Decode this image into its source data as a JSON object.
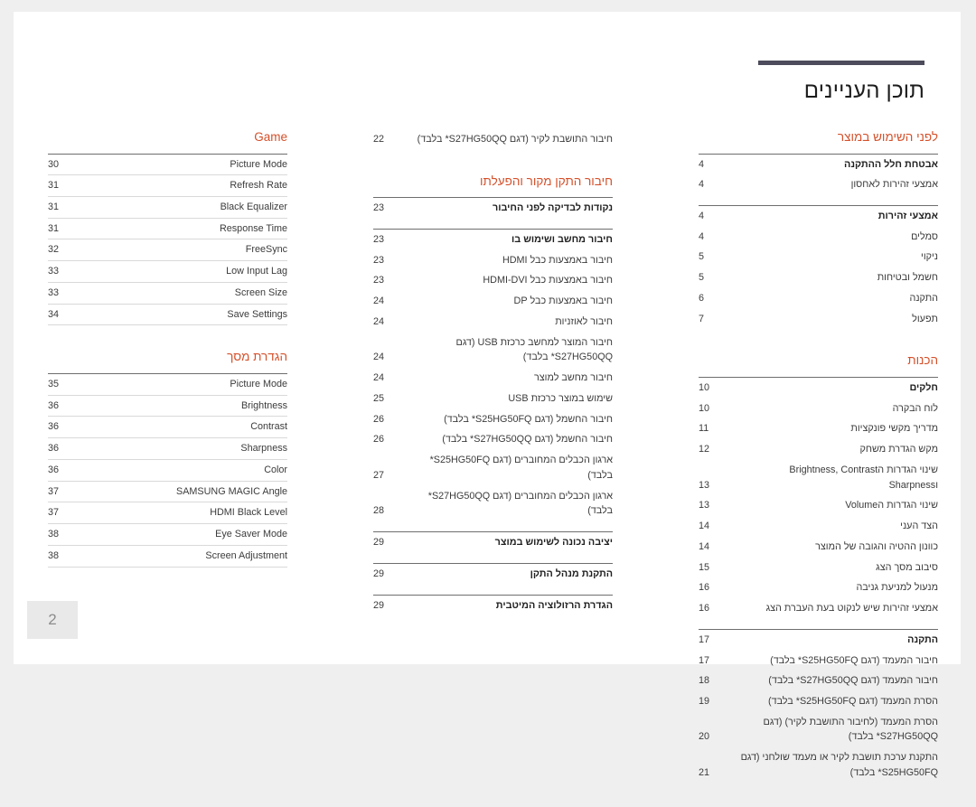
{
  "header": {
    "title": "תוכן העניינים"
  },
  "page_number": "2",
  "colors": {
    "accent": "#d4502a",
    "rule": "#4c4c5c",
    "text": "#3b3b3b",
    "page_bg": "#ffffff",
    "canvas_bg": "#efefef"
  },
  "columns": {
    "right": [
      {
        "title": "לפני השימוש במוצר",
        "title_dir": "rtl",
        "rule_each": false,
        "groups": [
          {
            "rows": [
              {
                "text": "אבטחת חלל ההתקנה",
                "page": "4",
                "bold": true,
                "dir": "rtl"
              },
              {
                "text": "אמצעי זהירות לאחסון",
                "page": "4",
                "bold": false,
                "dir": "rtl"
              }
            ]
          },
          {
            "rows": [
              {
                "text": "אמצעי זהירות",
                "page": "4",
                "bold": true,
                "dir": "rtl"
              },
              {
                "text": "סמלים",
                "page": "4",
                "bold": false,
                "dir": "rtl"
              },
              {
                "text": "ניקוי",
                "page": "5",
                "bold": false,
                "dir": "rtl"
              },
              {
                "text": "חשמל ובטיחות",
                "page": "5",
                "bold": false,
                "dir": "rtl"
              },
              {
                "text": "התקנה",
                "page": "6",
                "bold": false,
                "dir": "rtl"
              },
              {
                "text": "תפעול",
                "page": "7",
                "bold": false,
                "dir": "rtl"
              }
            ]
          }
        ]
      },
      {
        "title": "הכנות",
        "title_dir": "rtl",
        "rule_each": false,
        "groups": [
          {
            "rows": [
              {
                "text": "חלקים",
                "page": "10",
                "bold": true,
                "dir": "rtl"
              },
              {
                "text": "לוח הבקרה",
                "page": "10",
                "bold": false,
                "dir": "rtl"
              },
              {
                "text": "מדריך מקשי פונקציות",
                "page": "11",
                "bold": false,
                "dir": "rtl"
              },
              {
                "text": "מקש הגדרת משחק",
                "page": "12",
                "bold": false,
                "dir": "rtl"
              },
              {
                "text": "שינוי הגדרות הBrightness, Contrast וSharpness",
                "page": "13",
                "bold": false,
                "dir": "rtl"
              },
              {
                "text": "שינוי הגדרות הVolume",
                "page": "13",
                "bold": false,
                "dir": "rtl"
              },
              {
                "text": "הצד העני",
                "page": "14",
                "bold": false,
                "dir": "rtl"
              },
              {
                "text": "כוונון ההטיה והגובה של המוצר",
                "page": "14",
                "bold": false,
                "dir": "rtl"
              },
              {
                "text": "סיבוב מסך הצג",
                "page": "15",
                "bold": false,
                "dir": "rtl"
              },
              {
                "text": "מנעול למניעת גניבה",
                "page": "16",
                "bold": false,
                "dir": "rtl"
              },
              {
                "text": "אמצעי זהירות שיש לנקוט בעת העברת הצג",
                "page": "16",
                "bold": false,
                "dir": "rtl"
              }
            ]
          },
          {
            "rows": [
              {
                "text": "התקנה",
                "page": "17",
                "bold": true,
                "dir": "rtl"
              },
              {
                "text": "חיבור המעמד (דגם S25HG50FQ* בלבד)",
                "page": "17",
                "bold": false,
                "dir": "rtl"
              },
              {
                "text": "חיבור המעמד (דגם S27HG50QQ* בלבד)",
                "page": "18",
                "bold": false,
                "dir": "rtl"
              },
              {
                "text": "הסרת המעמד (דגם S25HG50FQ* בלבד)",
                "page": "19",
                "bold": false,
                "dir": "rtl"
              },
              {
                "text": "הסרת המעמד (לחיבור התושבת לקיר) (דגם S27HG50QQ* בלבד)",
                "page": "20",
                "bold": false,
                "dir": "rtl"
              },
              {
                "text": "התקנת ערכת תושבת לקיר או מעמד שולחני (דגם S25HG50FQ* בלבד)",
                "page": "21",
                "bold": false,
                "dir": "rtl"
              }
            ]
          }
        ]
      }
    ],
    "middle": [
      {
        "title": "",
        "title_dir": "rtl",
        "rule_each": false,
        "no_rule": true,
        "groups": [
          {
            "no_top_rule": true,
            "rows": [
              {
                "text": "חיבור התושבת לקיר (דגם S27HG50QQ* בלבד)",
                "page": "22",
                "bold": false,
                "dir": "rtl"
              }
            ]
          }
        ]
      },
      {
        "title": "חיבור התקן מקור והפעלתו",
        "title_dir": "rtl",
        "rule_each": false,
        "groups": [
          {
            "rows": [
              {
                "text": "נקודות לבדיקה לפני החיבור",
                "page": "23",
                "bold": true,
                "dir": "rtl"
              }
            ]
          },
          {
            "rows": [
              {
                "text": "חיבור מחשב ושימוש בו",
                "page": "23",
                "bold": true,
                "dir": "rtl"
              },
              {
                "text": "חיבור באמצעות כבל HDMI",
                "page": "23",
                "bold": false,
                "dir": "rtl"
              },
              {
                "text": "חיבור באמצעות כבל HDMI-DVI",
                "page": "23",
                "bold": false,
                "dir": "rtl"
              },
              {
                "text": "חיבור באמצעות כבל DP",
                "page": "24",
                "bold": false,
                "dir": "rtl"
              },
              {
                "text": "חיבור לאוזניות",
                "page": "24",
                "bold": false,
                "dir": "rtl"
              },
              {
                "text": "חיבור המוצר למחשב כרכזת USB (דגם S27HG50QQ* בלבד)",
                "page": "24",
                "bold": false,
                "dir": "rtl"
              },
              {
                "text": "חיבור מחשב למוצר",
                "page": "24",
                "bold": false,
                "dir": "rtl"
              },
              {
                "text": "שימוש במוצר כרכזת USB",
                "page": "25",
                "bold": false,
                "dir": "rtl"
              },
              {
                "text": "חיבור החשמל (דגם S25HG50FQ* בלבד)",
                "page": "26",
                "bold": false,
                "dir": "rtl"
              },
              {
                "text": "חיבור החשמל (דגם S27HG50QQ* בלבד)",
                "page": "26",
                "bold": false,
                "dir": "rtl"
              },
              {
                "text": "ארגון הכבלים המחוברים (דגם S25HG50FQ* בלבד)",
                "page": "27",
                "bold": false,
                "dir": "rtl"
              },
              {
                "text": "ארגון הכבלים המחוברים (דגם S27HG50QQ* בלבד)",
                "page": "28",
                "bold": false,
                "dir": "rtl"
              }
            ]
          },
          {
            "rows": [
              {
                "text": "יציבה נכונה לשימוש במוצר",
                "page": "29",
                "bold": true,
                "dir": "rtl"
              }
            ]
          },
          {
            "rows": [
              {
                "text": "התקנת מנהל התקן",
                "page": "29",
                "bold": true,
                "dir": "rtl"
              }
            ]
          },
          {
            "rows": [
              {
                "text": "הגדרת הרזולוציה המיטבית",
                "page": "29",
                "bold": true,
                "dir": "rtl"
              }
            ]
          }
        ]
      }
    ],
    "left": [
      {
        "title": "Game",
        "title_dir": "ltr",
        "rule_each": true,
        "groups": [
          {
            "rows": [
              {
                "text": "Picture Mode",
                "page": "30",
                "bold": false,
                "dir": "ltr"
              },
              {
                "text": "Refresh Rate",
                "page": "31",
                "bold": false,
                "dir": "ltr"
              },
              {
                "text": "Black Equalizer",
                "page": "31",
                "bold": false,
                "dir": "ltr"
              },
              {
                "text": "Response Time",
                "page": "31",
                "bold": false,
                "dir": "ltr"
              },
              {
                "text": "FreeSync",
                "page": "32",
                "bold": false,
                "dir": "ltr"
              },
              {
                "text": "Low Input Lag",
                "page": "33",
                "bold": false,
                "dir": "ltr"
              },
              {
                "text": "Screen Size",
                "page": "33",
                "bold": false,
                "dir": "ltr"
              },
              {
                "text": "Save Settings",
                "page": "34",
                "bold": false,
                "dir": "ltr"
              }
            ]
          }
        ]
      },
      {
        "title": "הגדרת מסך",
        "title_dir": "rtl",
        "rule_each": true,
        "groups": [
          {
            "rows": [
              {
                "text": "Picture Mode",
                "page": "35",
                "bold": false,
                "dir": "ltr"
              },
              {
                "text": "Brightness",
                "page": "36",
                "bold": false,
                "dir": "ltr"
              },
              {
                "text": "Contrast",
                "page": "36",
                "bold": false,
                "dir": "ltr"
              },
              {
                "text": "Sharpness",
                "page": "36",
                "bold": false,
                "dir": "ltr"
              },
              {
                "text": "Color",
                "page": "36",
                "bold": false,
                "dir": "ltr"
              },
              {
                "text": "SAMSUNG MAGIC Angle",
                "page": "37",
                "bold": false,
                "dir": "ltr"
              },
              {
                "text": "HDMI Black Level",
                "page": "37",
                "bold": false,
                "dir": "ltr"
              },
              {
                "text": "Eye Saver Mode",
                "page": "38",
                "bold": false,
                "dir": "ltr"
              },
              {
                "text": "Screen Adjustment",
                "page": "38",
                "bold": false,
                "dir": "ltr"
              }
            ]
          }
        ]
      }
    ]
  }
}
